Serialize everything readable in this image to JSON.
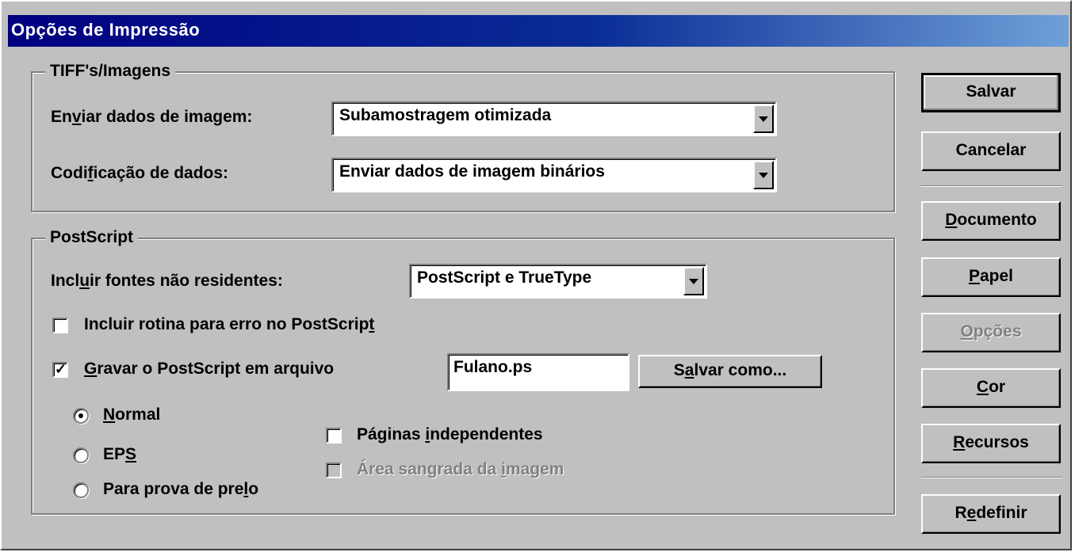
{
  "window": {
    "title": "Opções de Impressão"
  },
  "tiff_group": {
    "title": "TIFF's/Imagens",
    "send_image_data": {
      "label_pre": "En",
      "label_ul": "v",
      "label_post": "iar dados de imagem:",
      "value": "Subamostragem otimizada"
    },
    "data_encoding": {
      "label_pre": "Codi",
      "label_ul": "f",
      "label_post": "icação de dados:",
      "value": "Enviar dados de imagem binários"
    }
  },
  "postscript_group": {
    "title": "PostScript",
    "include_fonts": {
      "label_pre": "Incl",
      "label_ul": "u",
      "label_post": "ir fontes não residentes:",
      "value": "PostScript e TrueType"
    },
    "error_routine": {
      "label_pre": "Incluir rotina para erro no PostScrip",
      "label_ul": "t",
      "label_post": "",
      "checked": false
    },
    "write_to_file": {
      "label_pre": "",
      "label_ul": "G",
      "label_post": "ravar o PostScript em arquivo",
      "checked": true
    },
    "filename": "Fulano.ps",
    "save_as": {
      "pre": "S",
      "ul": "a",
      "post": "lvar como..."
    },
    "radio_normal": {
      "pre": "",
      "ul": "N",
      "post": "ormal",
      "selected": true
    },
    "radio_eps": {
      "pre": "EP",
      "ul": "S",
      "post": "",
      "selected": false
    },
    "radio_proof": {
      "pre": "Para prova de pre",
      "ul": "l",
      "post": "o",
      "selected": false
    },
    "independent_pages": {
      "pre": "Páginas ",
      "ul": "i",
      "post": "ndependentes",
      "checked": false
    },
    "bleed_area": {
      "pre": "Área sangrada da ",
      "ul": "i",
      "post": "magem",
      "checked": false,
      "disabled": true
    }
  },
  "buttons": {
    "save": {
      "pre": "Salvar",
      "ul": "",
      "post": ""
    },
    "cancel": {
      "pre": "Cancelar",
      "ul": "",
      "post": ""
    },
    "document": {
      "pre": "",
      "ul": "D",
      "post": "ocumento"
    },
    "paper": {
      "pre": "",
      "ul": "P",
      "post": "apel"
    },
    "options": {
      "pre": "",
      "ul": "O",
      "post": "pções"
    },
    "color": {
      "pre": "",
      "ul": "C",
      "post": "or"
    },
    "resources": {
      "pre": "",
      "ul": "R",
      "post": "ecursos"
    },
    "reset": {
      "pre": "R",
      "ul": "e",
      "post": "definir"
    }
  }
}
